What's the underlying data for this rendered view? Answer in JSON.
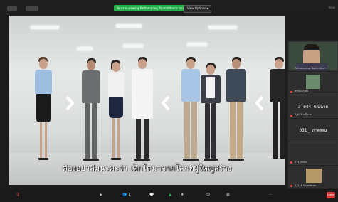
{
  "topbar": {
    "share_banner": "You are viewing Pathompong Taphimthon's screen",
    "stop_label": "View Options ▾",
    "view_label": "View"
  },
  "shared_screen": {
    "subtitle": "ต้องอย่าลืมนะคะว่า เด็กโตมาจากโลกที่ผู้ใหญ่สร้าง"
  },
  "participants": [
    {
      "name": "Pathompong Taphimthon",
      "label": ""
    },
    {
      "name": "พรรณจักษณ์",
      "label": ""
    },
    {
      "name": "2_044 มณีฉาย",
      "label": "3-044 ปณีฉาย"
    },
    {
      "name": "031_ภาคพณ",
      "label": "031_ ภาคพณ"
    },
    {
      "name": "031_Ketcu",
      "label": ""
    },
    {
      "name": "1_114 Sunethran",
      "label": ""
    }
  ],
  "toolbar": {
    "audio_label": "🎙",
    "video_label": "▶",
    "participants_count": "1",
    "chat_label": "💬",
    "share_label": "▲",
    "record_label": "⏺",
    "reactions_label": "☺",
    "apps_label": "▦",
    "more_label": "⋯",
    "leave_label": "Leave"
  },
  "colors": {
    "share_green": "#21b34a",
    "leave_red": "#d93838",
    "mic_muted_red": "#e04848"
  }
}
